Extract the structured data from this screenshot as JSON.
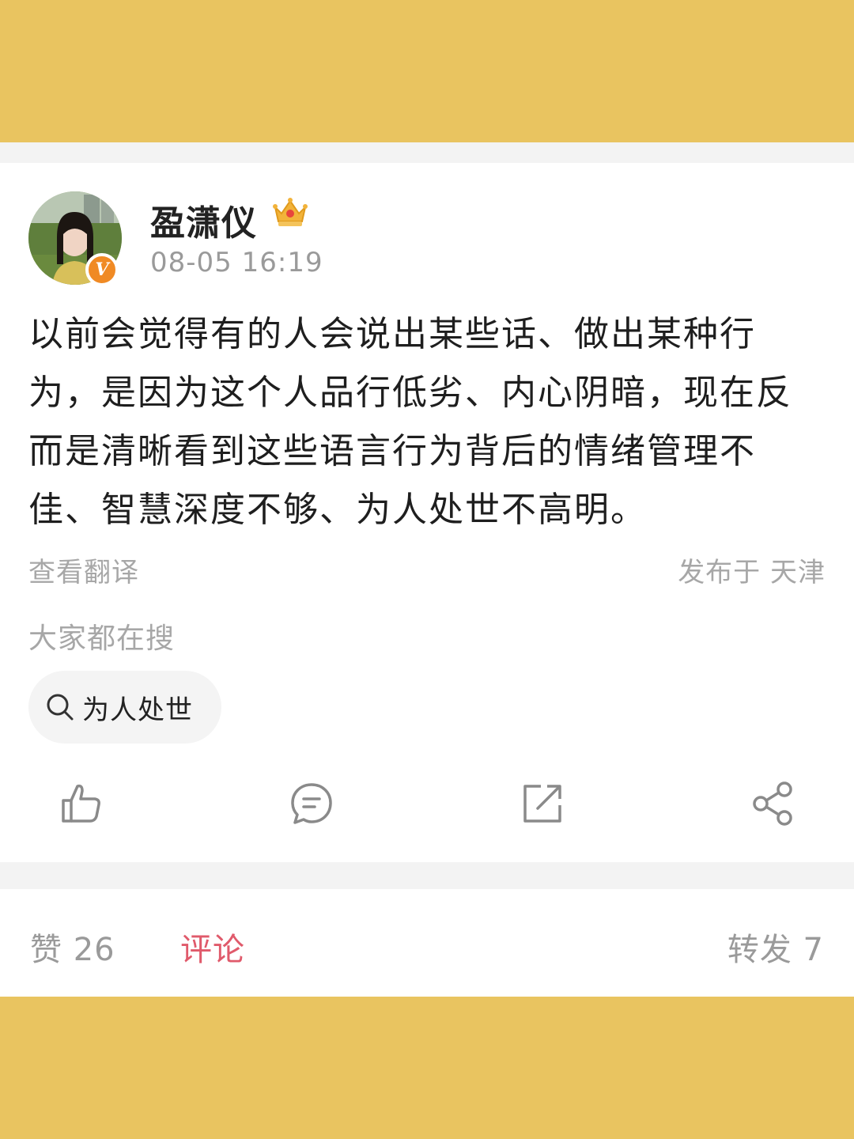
{
  "post": {
    "username": "盈潇仪",
    "timestamp": "08-05 16:19",
    "text": "以前会觉得有的人会说出某些话、做出某种行为，是因为这个人品行低劣、内心阴暗，现在反而是清晰看到这些语言行为背后的情绪管理不佳、智慧深度不够、为人处世不高明。",
    "translate_label": "查看翻译",
    "location": "发布于 天津",
    "verified_badge": "V"
  },
  "trending": {
    "label": "大家都在搜",
    "chips": [
      {
        "text": "为人处世",
        "icon": "search-icon"
      }
    ]
  },
  "actions": [
    {
      "name": "like",
      "icon": "thumbs-up-icon"
    },
    {
      "name": "comment",
      "icon": "comment-icon"
    },
    {
      "name": "repost",
      "icon": "repost-icon"
    },
    {
      "name": "share",
      "icon": "share-icon"
    }
  ],
  "stats": {
    "likes": "赞 26",
    "comments": "评论",
    "reposts": "转发 7"
  },
  "colors": {
    "background_band": "#e9c460",
    "accent": "#e05a6b",
    "verified": "#f08a24",
    "muted_text": "#a7a7a7"
  }
}
